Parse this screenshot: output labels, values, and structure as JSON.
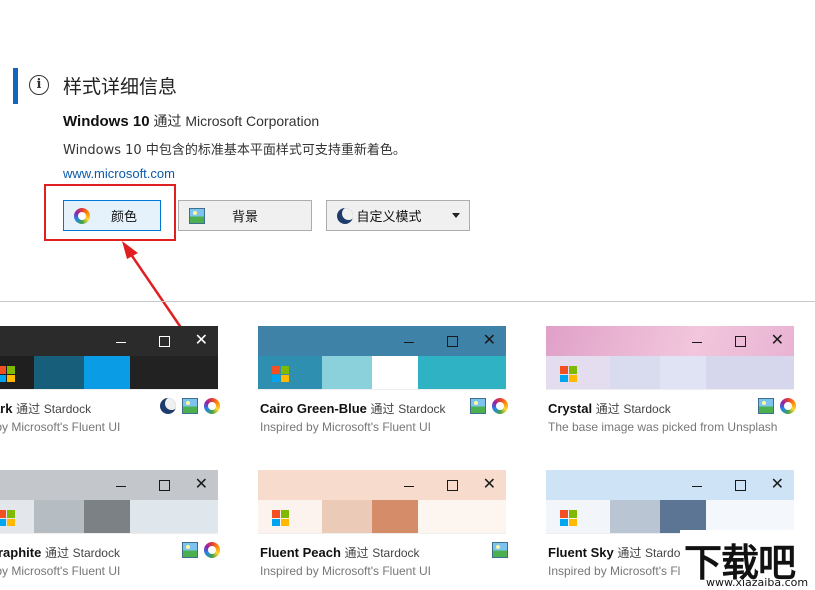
{
  "details": {
    "title": "样式详细信息",
    "theme_name": "Windows 10",
    "by_word": "通过",
    "publisher": "Microsoft Corporation",
    "description": "Windows 10 中包含的标准基本平面样式可支持重新着色。",
    "link": "www.microsoft.com"
  },
  "buttons": {
    "color": "颜色",
    "background": "背景",
    "custom_mode": "自定义模式"
  },
  "cards": [
    {
      "name": "o Dark",
      "by": "通过",
      "author": "Stardock",
      "sub": "ired by Microsoft's Fluent UI",
      "icons": [
        "crescent-icon",
        "picture-icon",
        "color-wheel-icon"
      ]
    },
    {
      "name": "Cairo Green-Blue",
      "by": "通过",
      "author": "Stardock",
      "sub": "Inspired by Microsoft's Fluent UI",
      "icons": [
        "picture-icon",
        "color-wheel-icon"
      ]
    },
    {
      "name": "Crystal",
      "by": "通过",
      "author": "Stardock",
      "sub": "The base image was picked from Unsplash",
      "icons": [
        "picture-icon",
        "color-wheel-icon"
      ]
    },
    {
      "name": "nt Graphite",
      "by": "通过",
      "author": "Stardock",
      "sub": "ired by Microsoft's Fluent UI",
      "icons": [
        "picture-icon",
        "color-wheel-icon"
      ]
    },
    {
      "name": "Fluent Peach",
      "by": "通过",
      "author": "Stardock",
      "sub": "Inspired by Microsoft's Fluent UI",
      "icons": [
        "picture-icon"
      ]
    },
    {
      "name": "Fluent Sky",
      "by": "通过",
      "author": "Stardo",
      "sub": "Inspired by Microsoft's Fluen",
      "icons": []
    }
  ],
  "titlebar_glyphs": {
    "close": "✕"
  },
  "watermark": {
    "main": "下载吧",
    "url": "www.xiazaiba.com"
  },
  "colors": {
    "accent": "#1565c0",
    "highlight": "#e02020",
    "link": "#0b5aad"
  }
}
